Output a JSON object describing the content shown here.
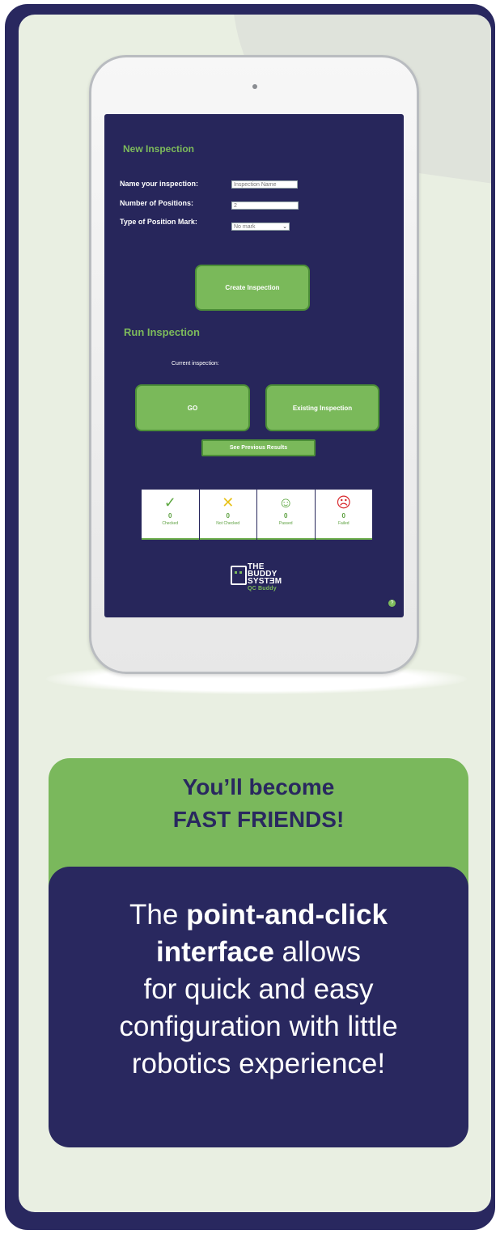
{
  "app": {
    "new_inspection": {
      "title": "New Inspection",
      "name_label": "Name your inspection:",
      "name_placeholder": "Inspection Name",
      "positions_label": "Number of Positions:",
      "positions_value": "2",
      "mark_label": "Type of Position Mark:",
      "mark_selected": "No mark",
      "create_button": "Create Inspection"
    },
    "run_inspection": {
      "title": "Run Inspection",
      "current_label": "Current inspection:",
      "go_button": "GO",
      "existing_button": "Existing Inspection",
      "previous_button": "See Previous Results"
    },
    "stats": [
      {
        "icon": "check-icon",
        "glyph": "✓",
        "color": "#5fa843",
        "value": "0",
        "label": "Checked"
      },
      {
        "icon": "x-icon",
        "glyph": "✕",
        "color": "#e8c21a",
        "value": "0",
        "label": "Not Checked"
      },
      {
        "icon": "smiley-icon",
        "glyph": "☺",
        "color": "#5fa843",
        "value": "0",
        "label": "Passed"
      },
      {
        "icon": "frown-icon",
        "glyph": "☹",
        "color": "#d8262b",
        "value": "0",
        "label": "Failed"
      }
    ],
    "logo": {
      "line1": "THE",
      "line2": "BUDDY",
      "line3": "SYSTƎM",
      "line4": "QC Buddy"
    },
    "help": "?"
  },
  "callout": {
    "headline_1": "You’ll become",
    "headline_2": "FAST FRIENDS!",
    "body_1": "The ",
    "body_bold_1": "point-and-click",
    "body_bold_2": "interface",
    "body_2": " allows",
    "body_3": "for quick and easy",
    "body_4": "configuration with little",
    "body_5": "robotics experience!"
  },
  "colors": {
    "navy": "#29285f",
    "green": "#7ab85c",
    "background": "#e9efe2"
  }
}
